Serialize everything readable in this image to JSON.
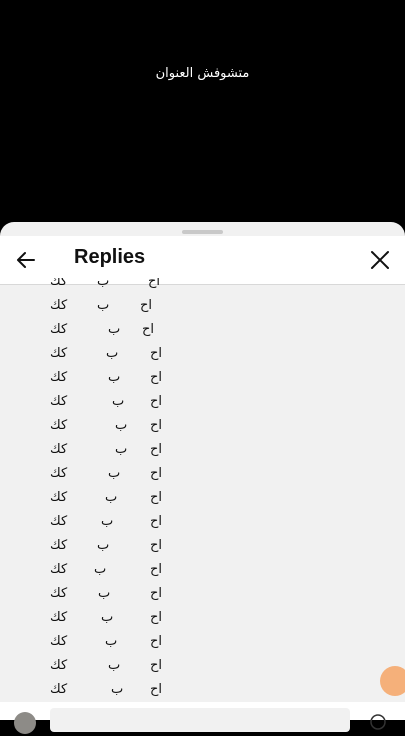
{
  "video": {
    "title": "متشوفش العنوان"
  },
  "sheet": {
    "title": "Replies"
  },
  "comment_lines": [
    {
      "a": "كك",
      "b": "ب",
      "c": "اح"
    },
    {
      "a": "كك",
      "b": "ب",
      "c": "اح"
    },
    {
      "a": "كك",
      "b": "ب",
      "c": "اح"
    },
    {
      "a": "كك",
      "b": "ب",
      "c": "اح"
    },
    {
      "a": "كك",
      "b": "ب",
      "c": "اح"
    },
    {
      "a": "كك",
      "b": "ب",
      "c": "اح"
    },
    {
      "a": "كك",
      "b": "ب",
      "c": "اح"
    },
    {
      "a": "كك",
      "b": "ب",
      "c": "اح"
    },
    {
      "a": "كك",
      "b": "ب",
      "c": "اح"
    },
    {
      "a": "كك",
      "b": "ب",
      "c": "اح"
    },
    {
      "a": "كك",
      "b": "ب",
      "c": "اح"
    },
    {
      "a": "كك",
      "b": "ب",
      "c": "اح"
    },
    {
      "a": "كك",
      "b": "ب",
      "c": "اح"
    },
    {
      "a": "كك",
      "b": "ب",
      "c": "اح"
    },
    {
      "a": "كك",
      "b": "ب",
      "c": "اح"
    },
    {
      "a": "كك",
      "b": "ب",
      "c": "اح"
    },
    {
      "a": "كك",
      "b": "ب",
      "c": "اح"
    },
    {
      "a": "كك",
      "b": "ب",
      "c": "اح"
    }
  ],
  "icons": {
    "back": "arrow-left-icon",
    "close": "close-icon",
    "emoji": "emoji-icon"
  }
}
